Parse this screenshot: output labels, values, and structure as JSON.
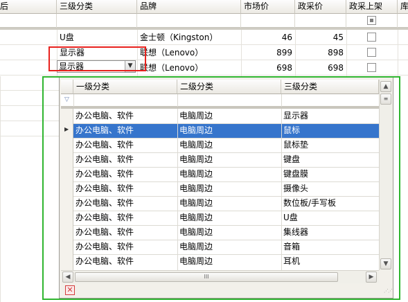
{
  "grid": {
    "columns": [
      "三级分类",
      "品牌",
      "市场价",
      "政采价",
      "政采上架",
      "库"
    ],
    "rows": [
      {
        "category": "U盘",
        "brand": "金士顿（Kingston）",
        "market_price": "46",
        "gov_price": "45",
        "listed": false
      },
      {
        "category": "显示器",
        "brand": "联想（Lenovo）",
        "market_price": "899",
        "gov_price": "898",
        "listed": false
      },
      {
        "category": "显示器",
        "brand": "联想（Lenovo）",
        "market_price": "698",
        "gov_price": "698",
        "listed": false
      }
    ]
  },
  "dropdown": {
    "columns": [
      "一级分类",
      "二级分类",
      "三级分类"
    ],
    "filter_icon": "funnel-icon",
    "selected_index": 1,
    "rows": [
      [
        "办公电脑、软件",
        "电脑周边",
        "显示器"
      ],
      [
        "办公电脑、软件",
        "电脑周边",
        "鼠标"
      ],
      [
        "办公电脑、软件",
        "电脑周边",
        "鼠标垫"
      ],
      [
        "办公电脑、软件",
        "电脑周边",
        "键盘"
      ],
      [
        "办公电脑、软件",
        "电脑周边",
        "键盘膜"
      ],
      [
        "办公电脑、软件",
        "电脑周边",
        "摄像头"
      ],
      [
        "办公电脑、软件",
        "电脑周边",
        "数位板/手写板"
      ],
      [
        "办公电脑、软件",
        "电脑周边",
        "U盘"
      ],
      [
        "办公电脑、软件",
        "电脑周边",
        "集线器"
      ],
      [
        "办公电脑、软件",
        "电脑周边",
        "音箱"
      ],
      [
        "办公电脑、软件",
        "电脑周边",
        "耳机"
      ]
    ],
    "scroll_grip": "III",
    "close_icon": "close-icon"
  },
  "colors": {
    "selection": "#3675cc",
    "highlight_red": "#e8211d",
    "highlight_green": "#2fb52f"
  }
}
